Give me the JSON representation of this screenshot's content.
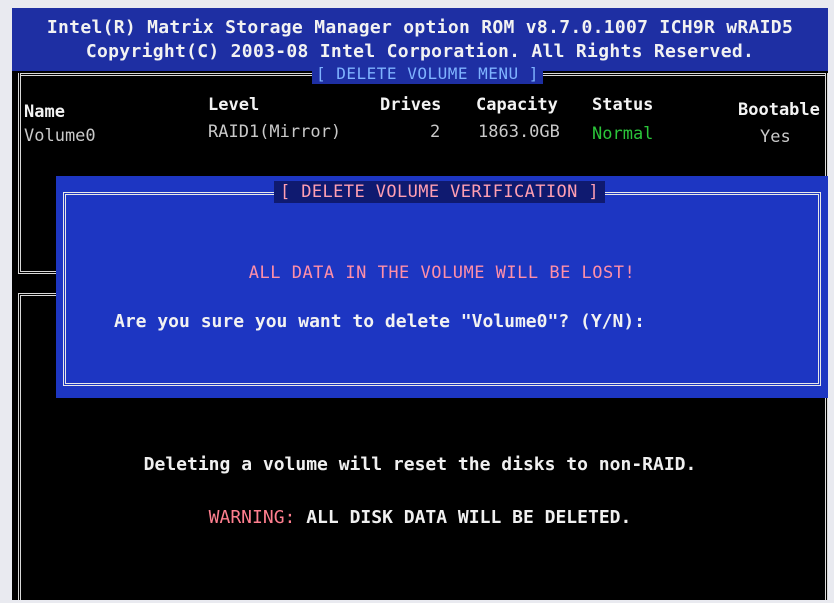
{
  "header": {
    "line1": "Intel(R) Matrix Storage Manager option ROM v8.7.0.1007 ICH9R wRAID5",
    "line2": "Copyright(C) 2003-08 Intel Corporation.  All Rights Reserved."
  },
  "menu_title": "[ DELETE VOLUME MENU ]",
  "table": {
    "headers": {
      "name": "Name",
      "level": "Level",
      "drives": "Drives",
      "capacity": "Capacity",
      "status": "Status",
      "bootable": "Bootable"
    },
    "rows": [
      {
        "name": "Volume0",
        "level": "RAID1(Mirror)",
        "drives": "2",
        "capacity": "1863.0GB",
        "status": "Normal",
        "bootable": "Yes"
      }
    ]
  },
  "dialog": {
    "title": "[ DELETE VOLUME VERIFICATION ]",
    "warning": "ALL DATA IN THE VOLUME WILL BE LOST!",
    "question": "Are you sure you want to delete \"Volume0\"? (Y/N):"
  },
  "footer": {
    "info": "Deleting a volume will reset the disks to non-RAID.",
    "warning_label": "WARNING:",
    "warning_text": "ALL DISK DATA WILL BE DELETED."
  },
  "colors": {
    "header_bg": "#1e2fa3",
    "dialog_bg": "#1d36c2",
    "status_ok": "#2bc53a",
    "warning": "#ff8fa8"
  }
}
